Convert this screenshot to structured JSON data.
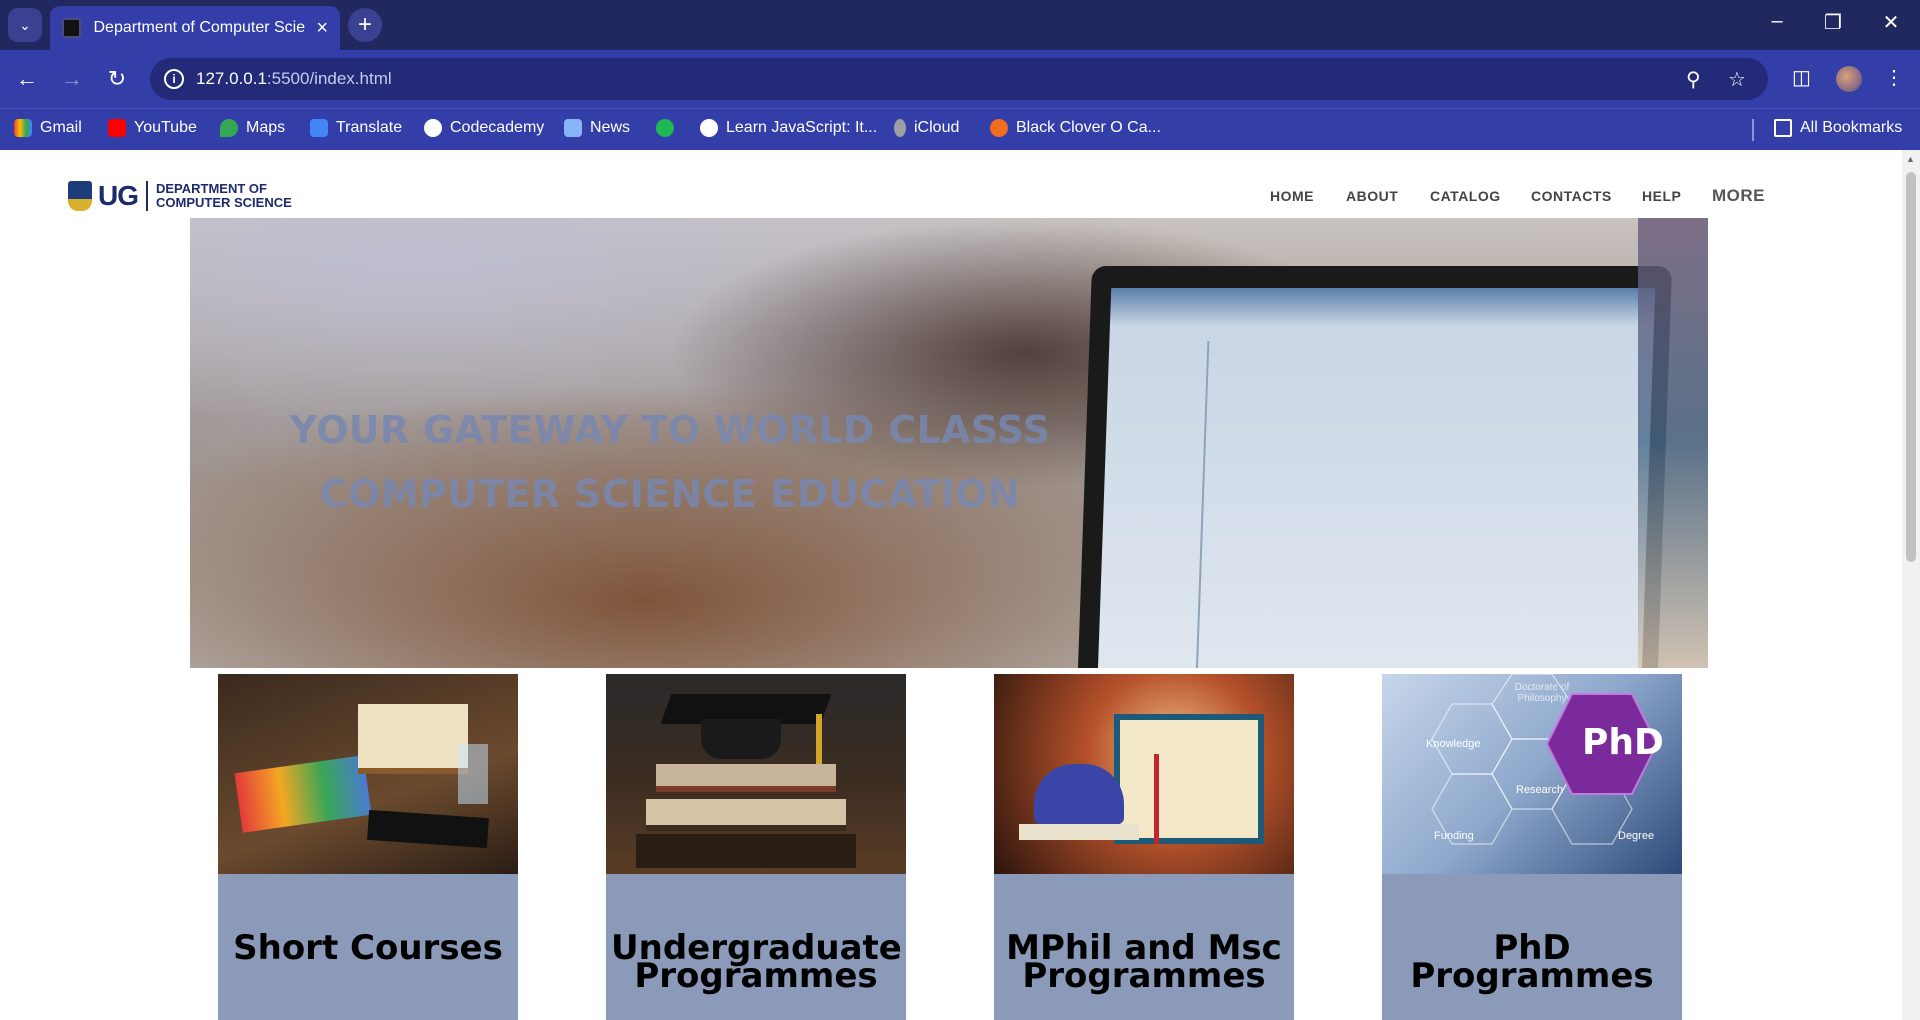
{
  "browser": {
    "tab_title": "Department of Computer Scier",
    "url_host": "127.0.0.1",
    "url_rest": ":5500/index.html",
    "bookmarks": [
      "Gmail",
      "YouTube",
      "Maps",
      "Translate",
      "Codecademy",
      "News",
      "Learn JavaScript: It...",
      "iCloud",
      "Black Clover O Ca...",
      "All Bookmarks"
    ],
    "icons": {
      "tab_search": "chevron-down-icon",
      "close_tab": "close-icon",
      "new_tab": "plus-icon",
      "back": "arrow-left-icon",
      "forward": "arrow-right-icon",
      "reload": "reload-icon",
      "site_info": "info-icon",
      "zoom": "zoom-icon",
      "bookmark": "star-icon",
      "side_panel": "side-panel-icon",
      "menu": "kebab-menu-icon"
    }
  },
  "site": {
    "logo_ug": "UG",
    "logo_line1": "DEPARTMENT OF",
    "logo_line2": "COMPUTER SCIENCE",
    "nav": [
      "HOME",
      "ABOUT",
      "CATALOG",
      "CONTACTS",
      "HELP",
      "MORE"
    ],
    "hero_heading": "YOUR GATEWAY TO WORLD CLASSS COMPUTER SCIENCE EDUCATION",
    "cards": [
      {
        "title": "Short Courses"
      },
      {
        "title": "Undergraduate Programmes"
      },
      {
        "title": "MPhil and Msc Programmes"
      },
      {
        "title": "PhD Programmes"
      }
    ],
    "phd_image_text": {
      "badge": "PhD",
      "top": "Doctorate of Philosophy",
      "knowledge": "Knowledge",
      "research": "Research",
      "funding": "Funding",
      "degree": "Degree"
    }
  },
  "colors": {
    "tab_strip": "#21275f",
    "toolbar": "#343ea8",
    "card_label_bg": "#8a9ab8",
    "hero_text": "#7887af"
  }
}
